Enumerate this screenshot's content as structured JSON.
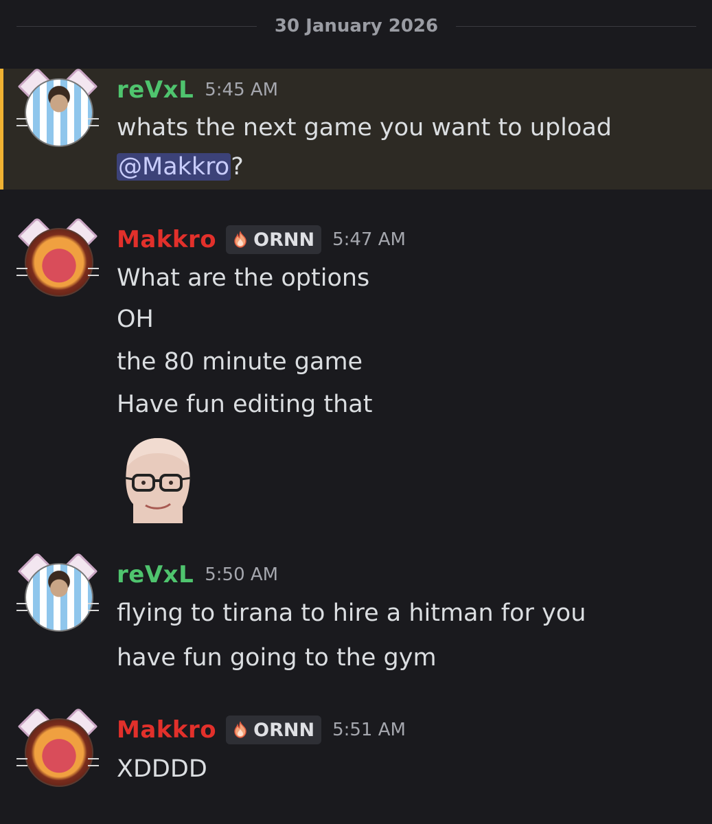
{
  "date_divider": "30 January 2026",
  "colors": {
    "background": "#1a1a1e",
    "highlight_bg": "#2d2a24",
    "highlight_border": "#f0b232",
    "author_green": "#4fc46e",
    "author_red": "#e2302b",
    "mention_bg": "#3c4278"
  },
  "messages": [
    {
      "author": "reVxL",
      "time": "5:45 AM",
      "avatar_icon": "messi-avatar-icon",
      "highlighted": true,
      "lines": [
        "whats the next game you want to upload",
        "@Makkro",
        "?"
      ]
    },
    {
      "author": "Makkro",
      "role": "ORNN",
      "role_icon": "fire-icon",
      "time": "5:47 AM",
      "avatar_icon": "ornn-avatar-icon",
      "lines": [
        "What are the options",
        "OH",
        "the 80 minute game",
        "Have fun editing that"
      ],
      "sticker_icon": "bald-man-glasses-emoji-icon"
    },
    {
      "author": "reVxL",
      "time": "5:50 AM",
      "avatar_icon": "messi-avatar-icon",
      "lines": [
        "flying to tirana to hire a hitman for you",
        "have fun going to the gym"
      ]
    },
    {
      "author": "Makkro",
      "role": "ORNN",
      "role_icon": "fire-icon",
      "time": "5:51 AM",
      "avatar_icon": "ornn-avatar-icon",
      "lines": [
        "XDDDD"
      ]
    }
  ]
}
